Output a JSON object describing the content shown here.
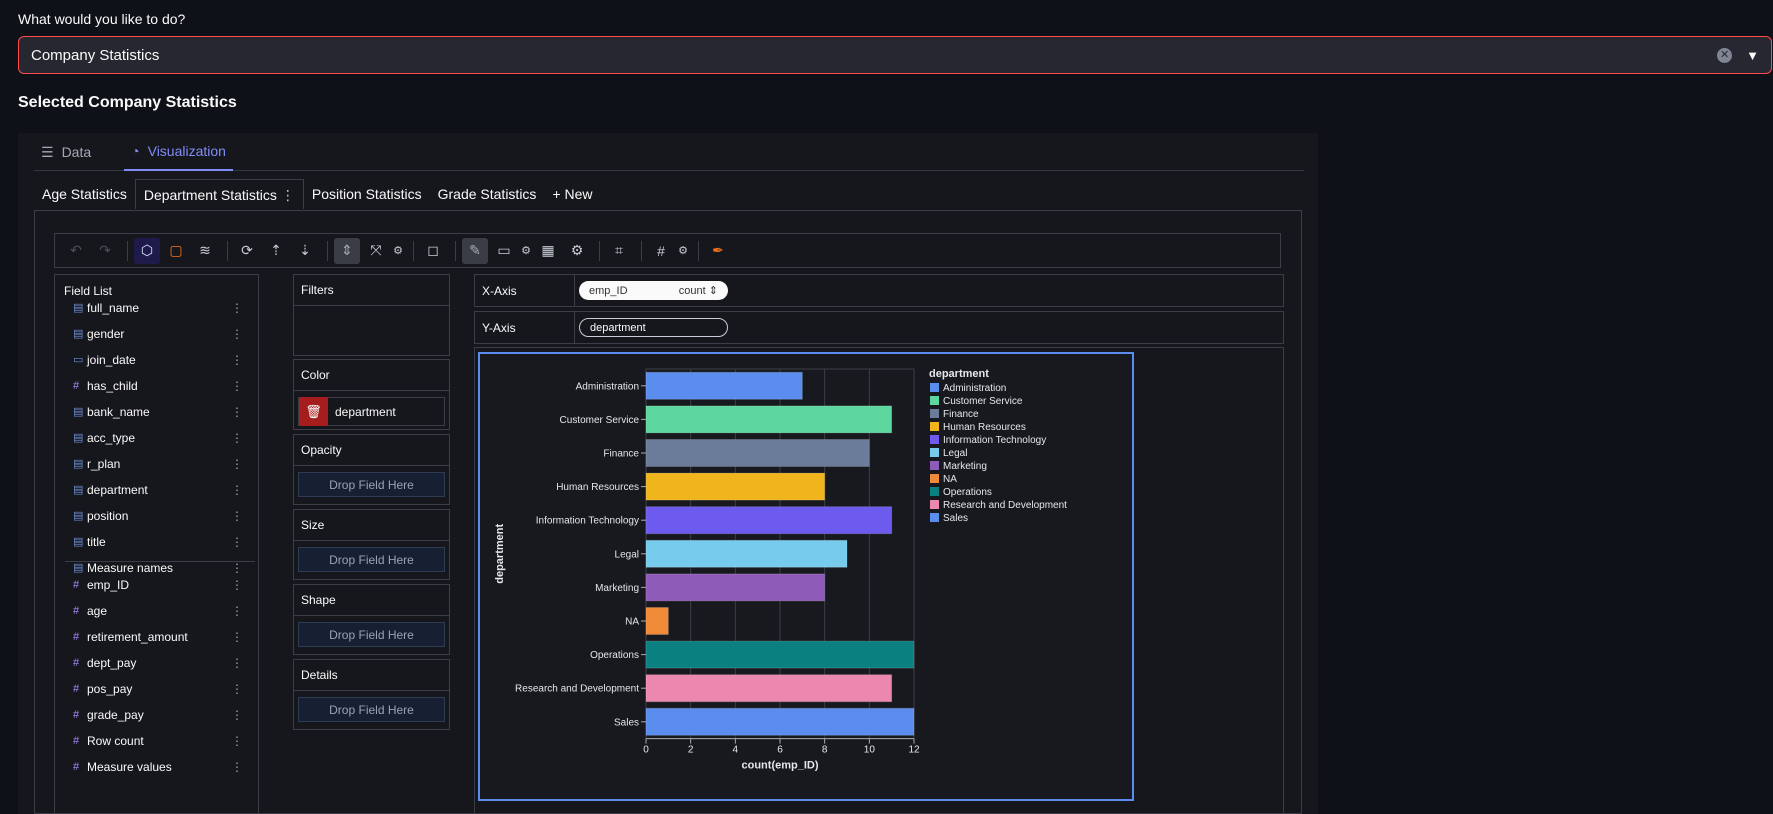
{
  "prompt": {
    "label": "What would you like to do?",
    "value": "Company Statistics",
    "clear_icon": "clear-icon",
    "chevron_icon": "chevron-down-icon"
  },
  "section_title": "Selected Company Statistics",
  "main_tabs": [
    {
      "label": "Data",
      "icon": "database-icon",
      "active": false
    },
    {
      "label": "Visualization",
      "icon": "chart-icon",
      "active": true
    }
  ],
  "chart_tabs": [
    {
      "label": "Age Statistics",
      "active": false
    },
    {
      "label": "Department Statistics",
      "active": true
    },
    {
      "label": "Position Statistics",
      "active": false
    },
    {
      "label": "Grade Statistics",
      "active": false
    },
    {
      "label": "+ New",
      "active": false
    }
  ],
  "field_list": {
    "title": "Field List",
    "dimensions": [
      "full_name",
      "gender",
      "join_date",
      "has_child",
      "bank_name",
      "acc_type",
      "r_plan",
      "department",
      "position",
      "title",
      "Measure names"
    ],
    "measures": [
      "emp_ID",
      "age",
      "retirement_amount",
      "dept_pay",
      "pos_pay",
      "grade_pay",
      "Row count",
      "Measure values"
    ]
  },
  "encodings": {
    "filters_label": "Filters",
    "color_label": "Color",
    "color_field": "department",
    "opacity_label": "Opacity",
    "size_label": "Size",
    "shape_label": "Shape",
    "details_label": "Details",
    "drop_text": "Drop Field Here"
  },
  "axes": {
    "x_label": "X-Axis",
    "x_field": "emp_ID",
    "x_agg": "count",
    "y_label": "Y-Axis",
    "y_field": "department"
  },
  "colors": {
    "accent": "#818cf8",
    "highlight_border": "#5b8def",
    "danger": "#a51d1d"
  },
  "chart_data": {
    "type": "bar",
    "orientation": "horizontal",
    "categories": [
      "Administration",
      "Customer Service",
      "Finance",
      "Human Resources",
      "Information Technology",
      "Legal",
      "Marketing",
      "NA",
      "Operations",
      "Research and Development",
      "Sales"
    ],
    "values": [
      7,
      11,
      10,
      8,
      11,
      9,
      8,
      1,
      12,
      11,
      12
    ],
    "colors": [
      "#5b8def",
      "#5ed6a0",
      "#6b7b9a",
      "#f0b51c",
      "#6d5bf0",
      "#77ccee",
      "#8e5cb8",
      "#f08a38",
      "#0b8080",
      "#ec87ad",
      "#5b8def"
    ],
    "xlabel": "count(emp_ID)",
    "ylabel": "department",
    "xlim": [
      0,
      12
    ],
    "xticks": [
      0,
      2,
      4,
      6,
      8,
      10,
      12
    ],
    "grid": true,
    "legend_title": "department",
    "legend_position": "right"
  }
}
